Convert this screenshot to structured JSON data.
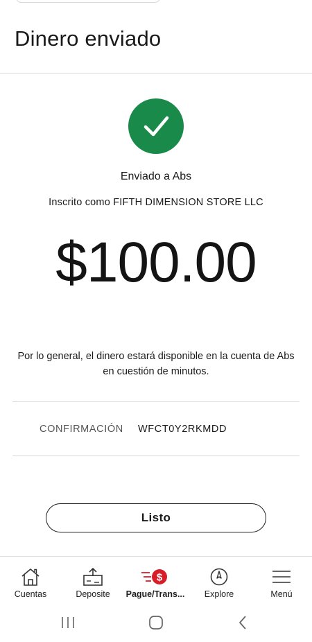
{
  "header": {
    "title": "Dinero enviado"
  },
  "confirmation": {
    "sent_to": "Enviado a Abs",
    "registered_as": "Inscrito como FIFTH DIMENSION STORE LLC",
    "amount": "$100.00",
    "availability_note": "Por lo general, el dinero estará disponible en la cuenta de Abs en cuestión de minutos.",
    "confirmation_label": "CONFIRMACIÓN",
    "confirmation_number": "WFCT0Y2RKMDD",
    "done_label": "Listo"
  },
  "colors": {
    "success_green": "#1a8a4a",
    "badge_red": "#d71e28"
  },
  "bottom_nav": {
    "items": [
      {
        "label": "Cuentas",
        "icon": "home-icon"
      },
      {
        "label": "Deposite",
        "icon": "deposit-icon"
      },
      {
        "label": "Pague/Trans...",
        "icon": "pay-transfer-icon",
        "active": true
      },
      {
        "label": "Explore",
        "icon": "compass-icon"
      },
      {
        "label": "Menú",
        "icon": "hamburger-menu-icon"
      }
    ]
  },
  "system_nav": {
    "icons": [
      "recent-apps-icon",
      "home-button-icon",
      "back-icon"
    ]
  }
}
